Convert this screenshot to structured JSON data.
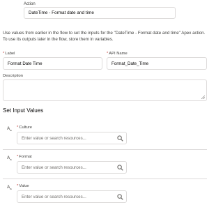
{
  "action": {
    "label": "Action",
    "value": "DateTime - Format date and time"
  },
  "description_text": "Use values from earlier in the flow to set the inputs for the \"DateTime - Format date and time\" Apex action. To use its outputs later in the flow, store them in variables.",
  "fields": {
    "label": {
      "label": "Label",
      "required_mark": "*",
      "value": "Format Date Time"
    },
    "api_name": {
      "label": "API Name",
      "required_mark": "*",
      "value": "Format_Date_Time"
    },
    "description": {
      "label": "Description",
      "value": ""
    }
  },
  "section_title": "Set Input Values",
  "inputs": [
    {
      "label": "Culture",
      "required_mark": "*",
      "placeholder": "Enter value or search resources...",
      "icon": "text-type-icon",
      "icon_text": "A",
      "icon_sub": "a"
    },
    {
      "label": "Format",
      "required_mark": "*",
      "placeholder": "Enter value or search resources...",
      "icon": "text-type-icon",
      "icon_text": "A",
      "icon_sub": "a"
    },
    {
      "label": "Value",
      "required_mark": "*",
      "placeholder": "Enter value or search resources...",
      "icon": "text-type-icon",
      "icon_text": "A",
      "icon_sub": "a"
    }
  ]
}
